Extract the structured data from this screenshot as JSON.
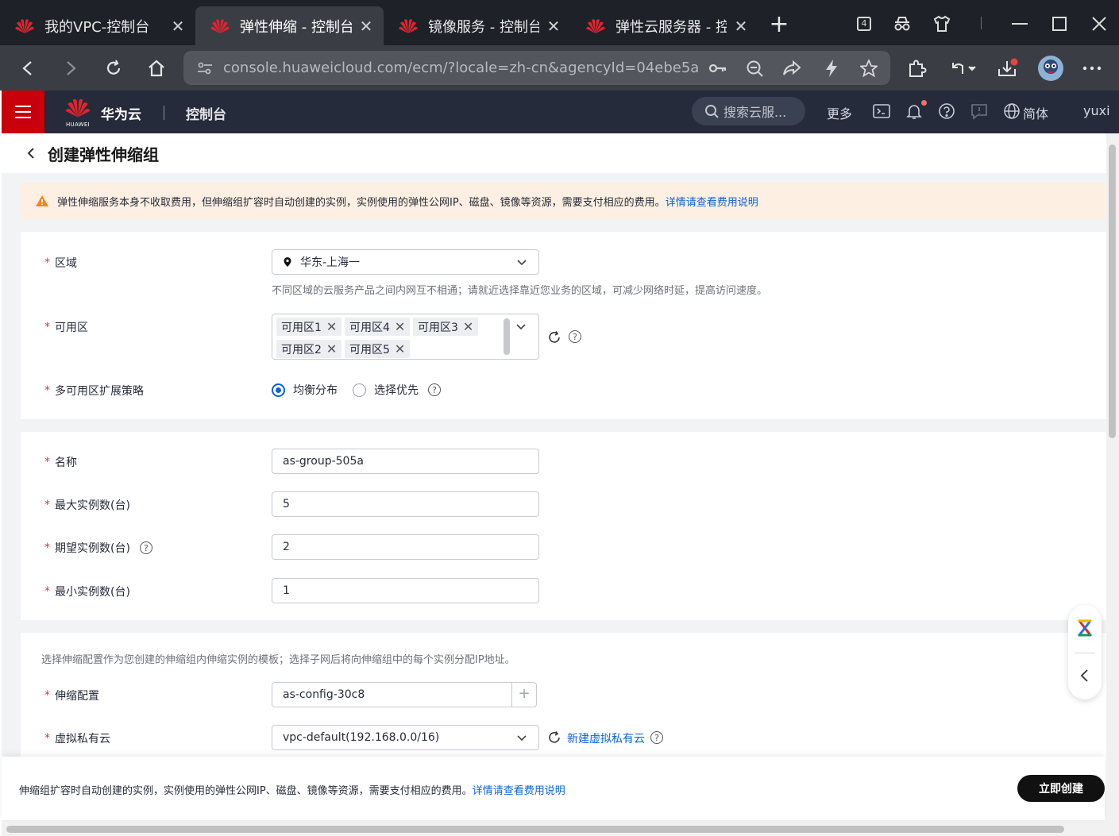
{
  "browser": {
    "tabs": [
      {
        "title": "我的VPC-控制台",
        "active": false
      },
      {
        "title": "弹性伸缩 - 控制台",
        "active": true
      },
      {
        "title": "镜像服务 - 控制台",
        "active": false
      },
      {
        "title": "弹性云服务器 - 控",
        "active": false
      }
    ],
    "tab_count": "4",
    "url": "console.huaweicloud.com/ecm/?locale=zh-cn&agencyId=04ebe5a..."
  },
  "header": {
    "brand_name": "华为云",
    "brand_sub": "HUAWEI",
    "console_label": "控制台",
    "search_placeholder": "搜索云服...",
    "more_label": "更多",
    "language_label": "简体",
    "user_label": "yuxi"
  },
  "page": {
    "title": "创建弹性伸缩组",
    "notice_text": "弹性伸缩服务本身不收取费用，但伸缩组扩容时自动创建的实例，实例使用的弹性公网IP、磁盘、镜像等资源，需要支付相应的费用。",
    "notice_link": "详情请查看费用说明"
  },
  "form": {
    "region": {
      "label": "区域",
      "value": "华东-上海一",
      "hint": "不同区域的云服务产品之间内网互不相通；请就近选择靠近您业务的区域，可减少网络时延，提高访问速度。"
    },
    "az": {
      "label": "可用区",
      "selected": [
        "可用区1",
        "可用区4",
        "可用区3",
        "可用区2",
        "可用区5"
      ]
    },
    "az_strategy": {
      "label": "多可用区扩展策略",
      "options": [
        "均衡分布",
        "选择优先"
      ],
      "selected": "均衡分布"
    },
    "name": {
      "label": "名称",
      "value": "as-group-505a"
    },
    "max_instances": {
      "label": "最大实例数(台)",
      "value": "5"
    },
    "expected_instances": {
      "label": "期望实例数(台)",
      "value": "2"
    },
    "min_instances": {
      "label": "最小实例数(台)",
      "value": "1"
    },
    "config_hint": "选择伸缩配置作为您创建的伸缩组内伸缩实例的模板；选择子网后将向伸缩组中的每个实例分配IP地址。",
    "scaling_config": {
      "label": "伸缩配置",
      "value": "as-config-30c8"
    },
    "vpc": {
      "label": "虚拟私有云",
      "value": "vpc-default(192.168.0.0/16)",
      "create_link": "新建虚拟私有云"
    }
  },
  "footer": {
    "text": "伸缩组扩容时自动创建的实例，实例使用的弹性公网IP、磁盘、镜像等资源，需要支付相应的费用。",
    "link": "详情请查看费用说明",
    "create_button": "立即创建"
  },
  "colors": {
    "huawei_red": "#c7000b",
    "header_bg": "#252b3a",
    "link_blue": "#0b63d9",
    "required_red": "#e0372e",
    "notice_bg": "#fdefe1"
  }
}
